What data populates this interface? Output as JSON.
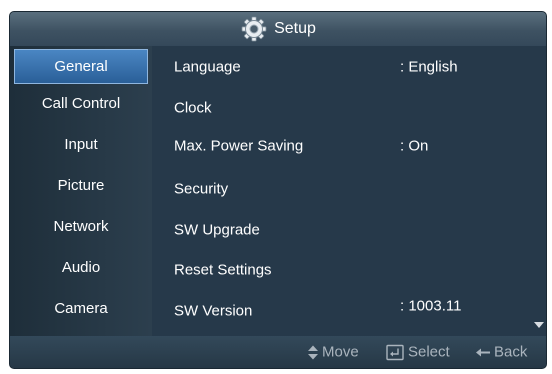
{
  "header": {
    "title": "Setup",
    "icon": "gear-icon"
  },
  "sidebar": {
    "items": [
      {
        "label": "General",
        "selected": true
      },
      {
        "label": "Call Control",
        "selected": false
      },
      {
        "label": "Input",
        "selected": false
      },
      {
        "label": "Picture",
        "selected": false
      },
      {
        "label": "Network",
        "selected": false
      },
      {
        "label": "Audio",
        "selected": false
      },
      {
        "label": "Camera",
        "selected": false
      }
    ]
  },
  "settings": {
    "rows": [
      {
        "label": "Language",
        "value": ": English"
      },
      {
        "label": "Clock",
        "value": ""
      },
      {
        "label": "Max. Power Saving",
        "value": ": On"
      },
      {
        "label": "Security",
        "value": ""
      },
      {
        "label": "SW Upgrade",
        "value": ""
      },
      {
        "label": "Reset Settings",
        "value": ""
      },
      {
        "label": "SW Version",
        "value": ": 1003.11"
      }
    ]
  },
  "footer": {
    "move_label": "Move",
    "select_label": "Select",
    "back_label": "Back",
    "move_icon": "up-down-arrows-icon",
    "select_icon": "enter-icon",
    "back_icon": "back-arrow-icon"
  },
  "colors": {
    "selected_accent": "#3a74b2",
    "panel_background": "#243744",
    "text": "#ffffff",
    "hint_text": "#aab4bd"
  }
}
